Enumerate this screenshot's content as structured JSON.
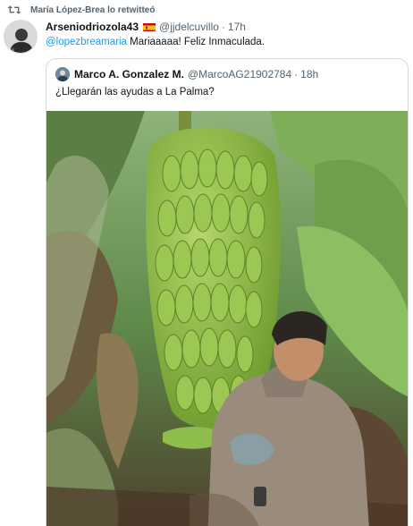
{
  "retweet": {
    "icon": "retweet-icon",
    "text": "María López-Brea lo retwitteó"
  },
  "tweet": {
    "author_name": "Arseniodriozola43",
    "flag_icon": "spain-flag-icon",
    "handle": "@jjdelcuvillo",
    "separator": "·",
    "time": "17h",
    "mention": "@lopezbreamaria",
    "text": " Mariaaaaa! Feliz Inmaculada."
  },
  "quote": {
    "author_name": "Marco A. Gonzalez M.",
    "handle": "@MarcoAG21902784",
    "separator": "·",
    "time": "18h",
    "text": "¿Llegarán las ayudas a La Palma?",
    "media_icon": "banana-plantation-photo"
  },
  "colors": {
    "link": "#1d9bf0",
    "secondary_text": "#536471",
    "border": "#cfd9de"
  }
}
